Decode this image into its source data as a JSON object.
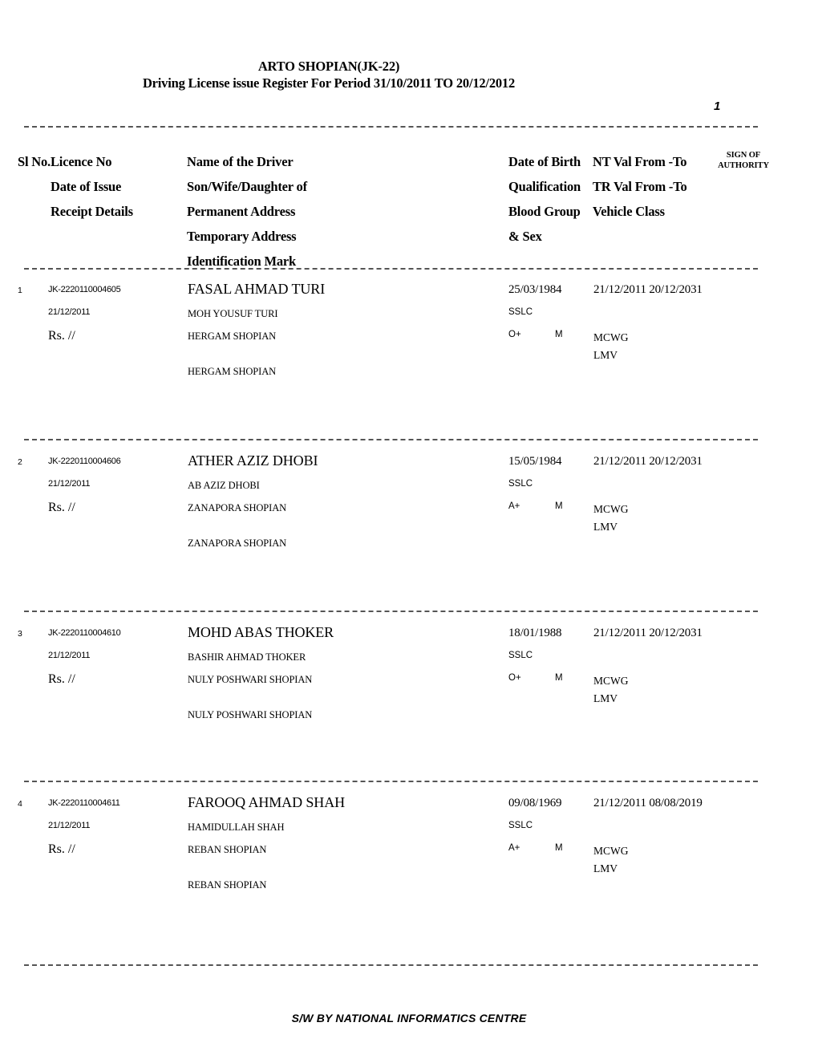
{
  "header": {
    "title": "ARTO SHOPIAN(JK-22)",
    "subtitle": "Driving License issue Register For Period 31/10/2011 TO 20/12/2012",
    "page_number": "1"
  },
  "column_headers": {
    "sl_no": "Sl No.",
    "col1": [
      "Licence No",
      "Date of Issue",
      "Receipt  Details"
    ],
    "col2": [
      "Name of the Driver",
      "Son/Wife/Daughter of",
      "Permanent Address",
      "Temporary Address",
      "Identification Mark"
    ],
    "col3": [
      "Date of Birth",
      "Qualification",
      "Blood Group",
      "& Sex"
    ],
    "col4": [
      "NT Val From -To",
      "TR Val From -To",
      "Vehicle Class"
    ],
    "sign_of_authority": [
      "SIGN OF",
      "AUTHORITY"
    ]
  },
  "rows": [
    {
      "sl_no": "1",
      "licence_no": "JK-2220110004605",
      "date_of_issue": "21/12/2011",
      "receipt_details": "Rs. //",
      "name": "FASAL AHMAD TURI",
      "relation": "MOH YOUSUF TURI",
      "permanent_address": "HERGAM SHOPIAN",
      "temporary_address": "HERGAM SHOPIAN",
      "identification_mark": "",
      "date_of_birth": "25/03/1984",
      "qualification": "SSLC",
      "blood_group": "O+",
      "sex": "M",
      "nt_val": "21/12/2011  20/12/2031",
      "tr_val": "",
      "vehicle_class": [
        "MCWG",
        "LMV"
      ]
    },
    {
      "sl_no": "2",
      "licence_no": "JK-2220110004606",
      "date_of_issue": "21/12/2011",
      "receipt_details": "Rs. //",
      "name": "ATHER AZIZ DHOBI",
      "relation": "AB AZIZ DHOBI",
      "permanent_address": "ZANAPORA SHOPIAN",
      "temporary_address": "ZANAPORA SHOPIAN",
      "identification_mark": "",
      "date_of_birth": "15/05/1984",
      "qualification": "SSLC",
      "blood_group": "A+",
      "sex": "M",
      "nt_val": "21/12/2011  20/12/2031",
      "tr_val": "",
      "vehicle_class": [
        "MCWG",
        "LMV"
      ]
    },
    {
      "sl_no": "3",
      "licence_no": "JK-2220110004610",
      "date_of_issue": "21/12/2011",
      "receipt_details": "Rs. //",
      "name": "MOHD ABAS THOKER",
      "relation": "BASHIR AHMAD THOKER",
      "permanent_address": "NULY POSHWARI SHOPIAN",
      "temporary_address": "NULY POSHWARI SHOPIAN",
      "identification_mark": "",
      "date_of_birth": "18/01/1988",
      "qualification": "SSLC",
      "blood_group": "O+",
      "sex": "M",
      "nt_val": "21/12/2011  20/12/2031",
      "tr_val": "",
      "vehicle_class": [
        "MCWG",
        "LMV"
      ]
    },
    {
      "sl_no": "4",
      "licence_no": "JK-2220110004611",
      "date_of_issue": "21/12/2011",
      "receipt_details": "Rs. //",
      "name": "FAROOQ AHMAD SHAH",
      "relation": "HAMIDULLAH SHAH",
      "permanent_address": "REBAN SHOPIAN",
      "temporary_address": "REBAN SHOPIAN",
      "identification_mark": "",
      "date_of_birth": "09/08/1969",
      "qualification": "SSLC",
      "blood_group": "A+",
      "sex": "M",
      "nt_val": "21/12/2011  08/08/2019",
      "tr_val": "",
      "vehicle_class": [
        "MCWG",
        "LMV"
      ]
    }
  ],
  "footer": {
    "text": "S/W BY NATIONAL INFORMATICS CENTRE"
  }
}
